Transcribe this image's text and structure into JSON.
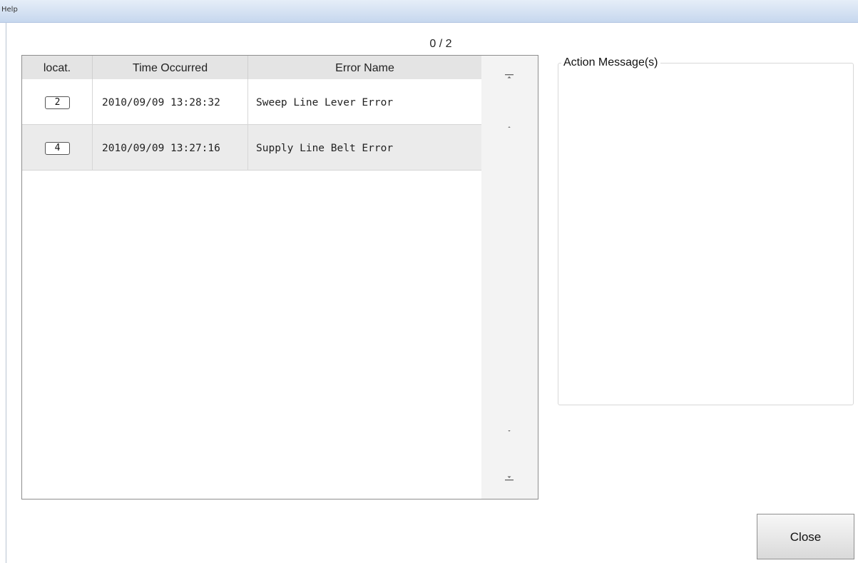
{
  "window": {
    "title": "Help"
  },
  "counter": "0 / 2",
  "table": {
    "headers": {
      "location": "locat.",
      "time": "Time Occurred",
      "error": "Error Name"
    },
    "rows": [
      {
        "location": "2",
        "time": "2010/09/09 13:28:32",
        "error": "Sweep Line Lever Error"
      },
      {
        "location": "4",
        "time": "2010/09/09 13:27:16",
        "error": "Supply Line Belt Error"
      }
    ]
  },
  "action_panel": {
    "label": "Action Message(s)",
    "message": ""
  },
  "buttons": {
    "close": "Close"
  },
  "icons": [
    "scroll-top-icon",
    "scroll-up-icon",
    "scroll-down-icon",
    "scroll-bottom-icon"
  ]
}
